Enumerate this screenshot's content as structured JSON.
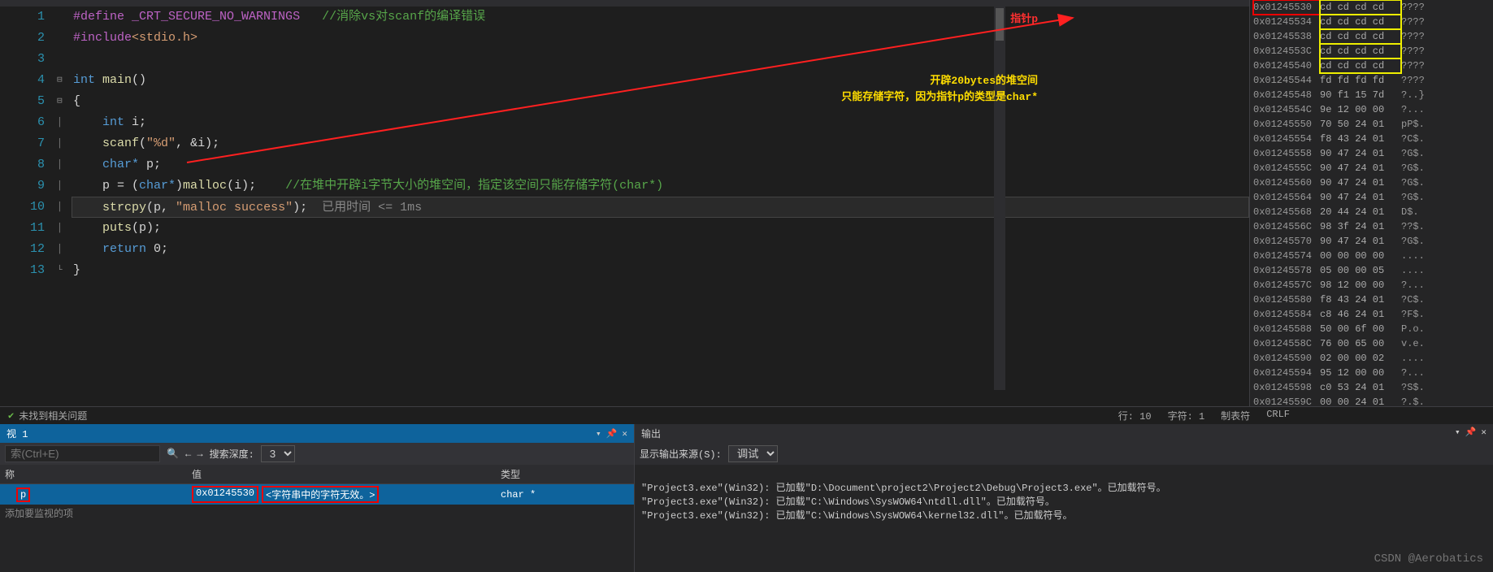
{
  "project": "Project3",
  "breadcrumb": "main()",
  "code": {
    "lines": [
      1,
      2,
      3,
      4,
      5,
      6,
      7,
      8,
      9,
      10,
      11,
      12,
      13
    ],
    "l1_define": "#define",
    "l1_macro": "_CRT_SECURE_NO_WARNINGS",
    "l1_comment": "//消除vs对scanf的编译错误",
    "l2_include": "#include",
    "l2_hdr": "<stdio.h>",
    "l4_int": "int",
    "l4_main": "main",
    "l4_paren": "()",
    "l5": "{",
    "l6_int": "int",
    "l6_rest": " i;",
    "l7_scanf": "scanf",
    "l7_args": "(\"%d\", &i);",
    "l7_fmt": "\"%d\"",
    "l8_char": "char*",
    "l8_rest": " p;",
    "l9_p": "p = (",
    "l9_cast": "char*",
    "l9_malloc": ")malloc(i);",
    "l9_comment": "//在堆中开辟i字节大小的堆空间，指定该空间只能存储字符(char*)",
    "l10_strcpy": "strcpy",
    "l10_args_a": "(p, ",
    "l10_str": "\"malloc success\"",
    "l10_args_b": ");",
    "l10_timing": "已用时间 <= 1ms",
    "l11_puts": "puts",
    "l11_args": "(p);",
    "l12_return": "return",
    "l12_rest": " 0;",
    "l13": "}"
  },
  "annotations": {
    "pointer_p": "指针p",
    "heap20": "开辟20bytes的堆空间",
    "char_only": "只能存储字符，因为指针p的类型是char*"
  },
  "memory": [
    {
      "addr": "0x01245530",
      "hex": "cd cd cd cd",
      "asc": "????",
      "hl": "both"
    },
    {
      "addr": "0x01245534",
      "hex": "cd cd cd cd",
      "asc": "????",
      "hl": "yel"
    },
    {
      "addr": "0x01245538",
      "hex": "cd cd cd cd",
      "asc": "????",
      "hl": "yel"
    },
    {
      "addr": "0x0124553C",
      "hex": "cd cd cd cd",
      "asc": "????",
      "hl": "yel"
    },
    {
      "addr": "0x01245540",
      "hex": "cd cd cd cd",
      "asc": "????",
      "hl": "yel"
    },
    {
      "addr": "0x01245544",
      "hex": "fd fd fd fd",
      "asc": "????"
    },
    {
      "addr": "0x01245548",
      "hex": "90 f1 15 7d",
      "asc": "?..}"
    },
    {
      "addr": "0x0124554C",
      "hex": "9e 12 00 00",
      "asc": "?..."
    },
    {
      "addr": "0x01245550",
      "hex": "70 50 24 01",
      "asc": "pP$."
    },
    {
      "addr": "0x01245554",
      "hex": "f8 43 24 01",
      "asc": "?C$."
    },
    {
      "addr": "0x01245558",
      "hex": "90 47 24 01",
      "asc": "?G$."
    },
    {
      "addr": "0x0124555C",
      "hex": "90 47 24 01",
      "asc": "?G$."
    },
    {
      "addr": "0x01245560",
      "hex": "90 47 24 01",
      "asc": "?G$."
    },
    {
      "addr": "0x01245564",
      "hex": "90 47 24 01",
      "asc": "?G$."
    },
    {
      "addr": "0x01245568",
      "hex": "20 44 24 01",
      "asc": " D$."
    },
    {
      "addr": "0x0124556C",
      "hex": "98 3f 24 01",
      "asc": "??$."
    },
    {
      "addr": "0x01245570",
      "hex": "90 47 24 01",
      "asc": "?G$."
    },
    {
      "addr": "0x01245574",
      "hex": "00 00 00 00",
      "asc": "...."
    },
    {
      "addr": "0x01245578",
      "hex": "05 00 00 05",
      "asc": "...."
    },
    {
      "addr": "0x0124557C",
      "hex": "98 12 00 00",
      "asc": "?..."
    },
    {
      "addr": "0x01245580",
      "hex": "f8 43 24 01",
      "asc": "?C$."
    },
    {
      "addr": "0x01245584",
      "hex": "c8 46 24 01",
      "asc": "?F$."
    },
    {
      "addr": "0x01245588",
      "hex": "50 00 6f 00",
      "asc": "P.o."
    },
    {
      "addr": "0x0124558C",
      "hex": "76 00 65 00",
      "asc": "v.e."
    },
    {
      "addr": "0x01245590",
      "hex": "02 00 00 02",
      "asc": "...."
    },
    {
      "addr": "0x01245594",
      "hex": "95 12 00 00",
      "asc": "?..."
    },
    {
      "addr": "0x01245598",
      "hex": "c0 53 24 01",
      "asc": "?S$."
    },
    {
      "addr": "0x0124559C",
      "hex": "00 00 24 01",
      "asc": "?.$."
    }
  ],
  "status": {
    "issues": "未找到相关问题",
    "line_lbl": "行:",
    "line": "10",
    "char_lbl": "字符:",
    "char": "1",
    "tabs": "制表符",
    "crlf": "CRLF"
  },
  "watch": {
    "title": "视 1",
    "search_ph": "索(Ctrl+E)",
    "depth_lbl": "搜索深度:",
    "depth": "3",
    "col_name": "称",
    "col_val": "值",
    "col_type": "类型",
    "var_name": "p",
    "var_val_addr": "0x01245530",
    "var_val_msg": "<字符串中的字符无效。>",
    "var_type": "char *",
    "add_item": "添加要监视的项"
  },
  "output": {
    "title": "输出",
    "src_lbl": "显示输出来源(S):",
    "src_val": "调试",
    "l1": "\"Project3.exe\"(Win32): 已加载\"D:\\Document\\project2\\Project2\\Debug\\Project3.exe\"。已加载符号。",
    "l2": "\"Project3.exe\"(Win32): 已加载\"C:\\Windows\\SysWOW64\\ntdll.dll\"。已加载符号。",
    "l3": "\"Project3.exe\"(Win32): 已加载\"C:\\Windows\\SysWOW64\\kernel32.dll\"。已加载符号。"
  },
  "watermark": "CSDN @Aerobatics"
}
